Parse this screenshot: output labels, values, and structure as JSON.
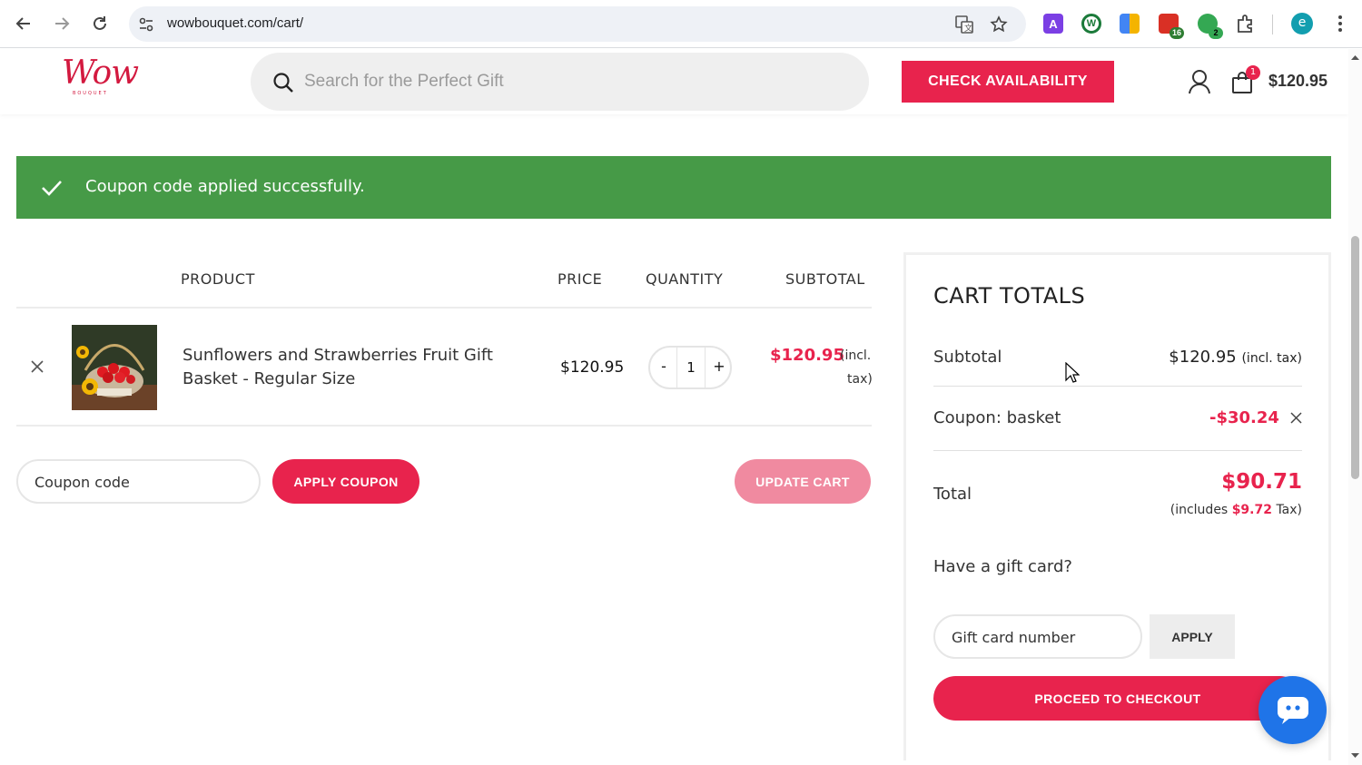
{
  "browser": {
    "url": "wowbouquet.com/cart/",
    "extensions": [
      {
        "name": "A",
        "color": "#7b3fe4",
        "badge": ""
      },
      {
        "name": "W",
        "color": "#1b7a3a",
        "badge": ""
      },
      {
        "name": "tiles",
        "color": "#f4b400",
        "badge": ""
      },
      {
        "name": "stack",
        "color": "#d93025",
        "badge": "16"
      },
      {
        "name": "sync",
        "color": "#34a853",
        "badge": "2"
      }
    ],
    "profile_initial": "e"
  },
  "header": {
    "logo_text": "Wow",
    "logo_sub": "BOUQUET",
    "search_placeholder": "Search for the Perfect Gift",
    "check_availability": "CHECK AVAILABILITY",
    "cart_count": "1",
    "cart_total": "$120.95"
  },
  "notice": {
    "message": "Coupon code applied successfully.",
    "color": "#469a47"
  },
  "cart": {
    "headers": {
      "product": "PRODUCT",
      "price": "PRICE",
      "quantity": "QUANTITY",
      "subtotal": "SUBTOTAL"
    },
    "items": [
      {
        "name": "Sunflowers and Strawberries Fruit Gift Basket - Regular Size",
        "price": "$120.95",
        "quantity": "1",
        "subtotal": "$120.95",
        "subtotal_note_1": "(incl.",
        "subtotal_note_2": "tax)"
      }
    ],
    "qty_minus": "-",
    "qty_plus": "+",
    "coupon_placeholder": "Coupon code",
    "apply_coupon": "APPLY COUPON",
    "update_cart": "UPDATE CART"
  },
  "totals": {
    "title": "CART TOTALS",
    "subtotal_label": "Subtotal",
    "subtotal_value": "$120.95",
    "subtotal_note": "(incl. tax)",
    "coupon_label": "Coupon: basket",
    "coupon_value": "-$30.24",
    "total_label": "Total",
    "total_value": "$90.71",
    "tax_prefix": "(includes",
    "tax_value": "$9.72",
    "tax_suffix": "Tax)",
    "gift_question": "Have a gift card?",
    "gift_placeholder": "Gift card number",
    "gift_apply": "APPLY",
    "checkout": "PROCEED TO CHECKOUT"
  },
  "colors": {
    "accent": "#e8234d",
    "accent_light": "#f08aa0",
    "chat": "#1f74e8"
  }
}
